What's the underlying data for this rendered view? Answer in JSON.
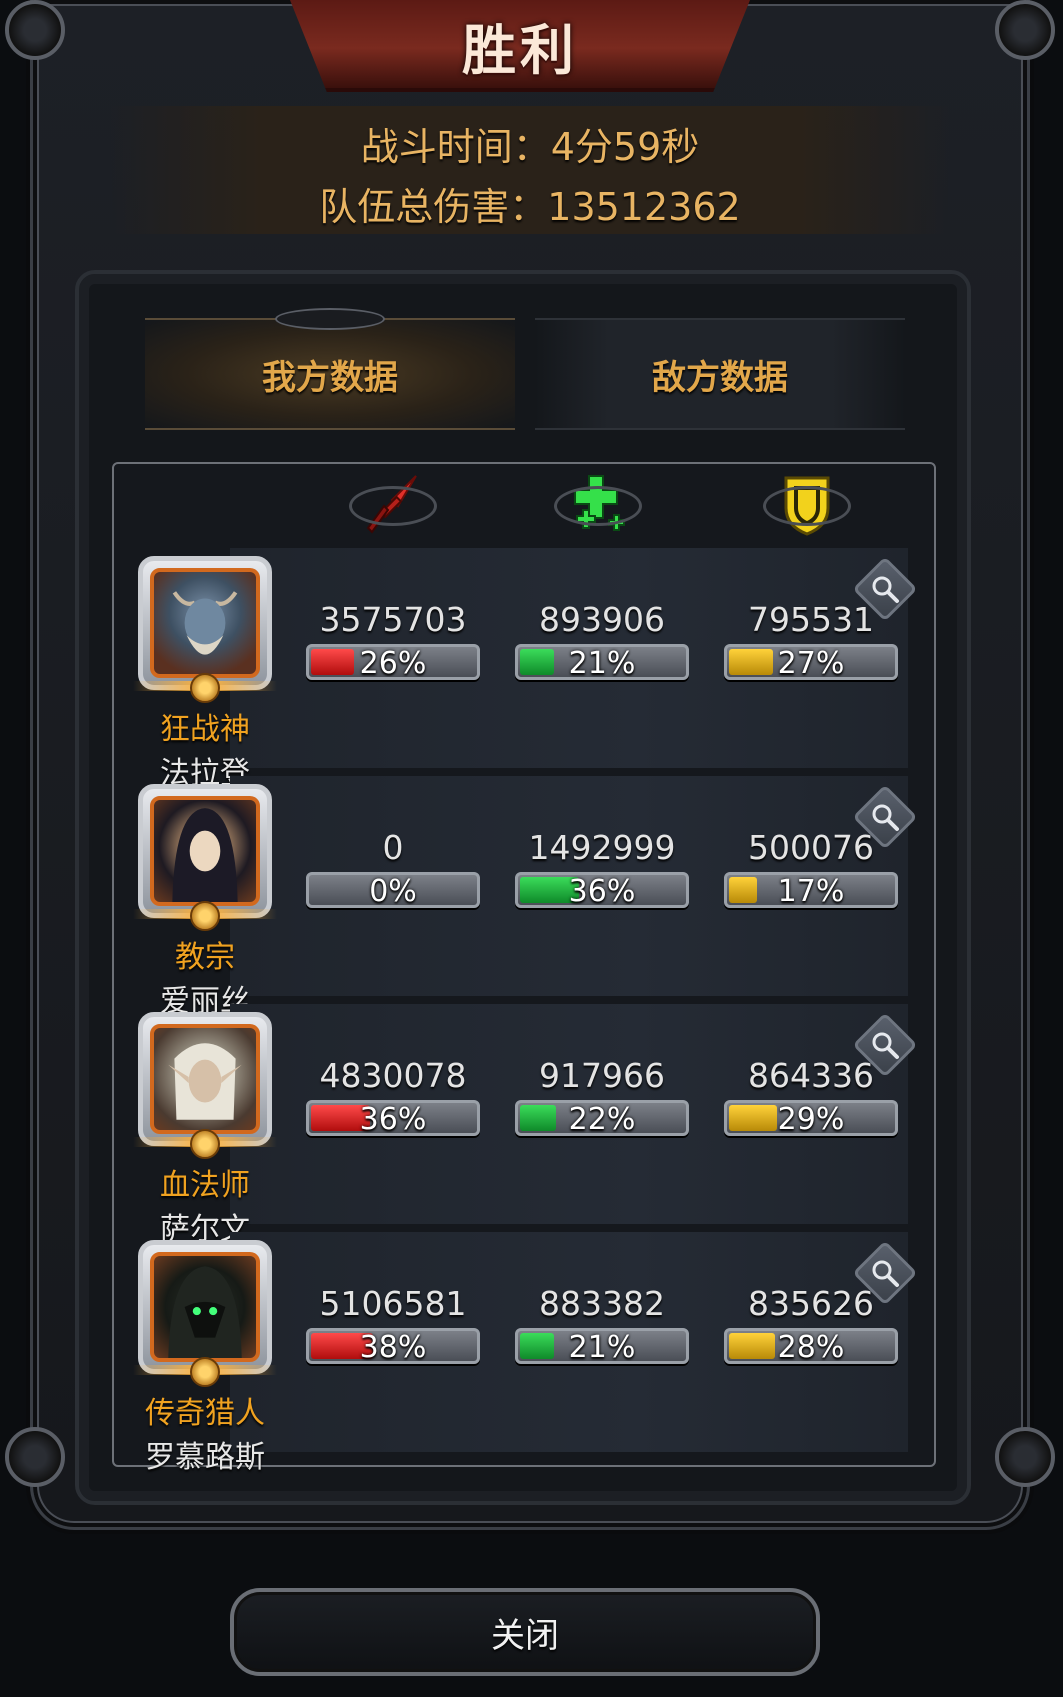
{
  "header": {
    "title": "胜利",
    "battle_time": "战斗时间：4分59秒",
    "team_damage": "队伍总伤害：13512362"
  },
  "tabs": [
    {
      "label": "我方数据",
      "active": true
    },
    {
      "label": "敌方数据",
      "active": false
    }
  ],
  "columns": [
    {
      "icon": "sword-icon",
      "color": "#e0302a"
    },
    {
      "icon": "heal-cross-icon",
      "color": "#35e04a"
    },
    {
      "icon": "shield-icon",
      "color": "#f2d21c"
    }
  ],
  "heroes": [
    {
      "title": "狂战神",
      "name": "法拉登",
      "portrait": "horned-demon-portrait",
      "damage": {
        "value": "3575703",
        "pct_label": "26%",
        "pct": 26
      },
      "heal": {
        "value": "893906",
        "pct_label": "21%",
        "pct": 21
      },
      "tank": {
        "value": "795531",
        "pct_label": "27%",
        "pct": 27
      }
    },
    {
      "title": "教宗",
      "name": "爱丽丝",
      "portrait": "hooded-priestess-portrait",
      "damage": {
        "value": "0",
        "pct_label": "0%",
        "pct": 0
      },
      "heal": {
        "value": "1492999",
        "pct_label": "36%",
        "pct": 36
      },
      "tank": {
        "value": "500076",
        "pct_label": "17%",
        "pct": 17
      }
    },
    {
      "title": "血法师",
      "name": "萨尔文",
      "portrait": "elf-mage-portrait",
      "damage": {
        "value": "4830078",
        "pct_label": "36%",
        "pct": 36
      },
      "heal": {
        "value": "917966",
        "pct_label": "22%",
        "pct": 22
      },
      "tank": {
        "value": "864336",
        "pct_label": "29%",
        "pct": 29
      }
    },
    {
      "title": "传奇猎人",
      "name": "罗慕路斯",
      "portrait": "hooded-hunter-portrait",
      "damage": {
        "value": "5106581",
        "pct_label": "38%",
        "pct": 38
      },
      "heal": {
        "value": "883382",
        "pct_label": "21%",
        "pct": 21
      },
      "tank": {
        "value": "835626",
        "pct_label": "28%",
        "pct": 28
      }
    }
  ],
  "close_label": "关闭"
}
